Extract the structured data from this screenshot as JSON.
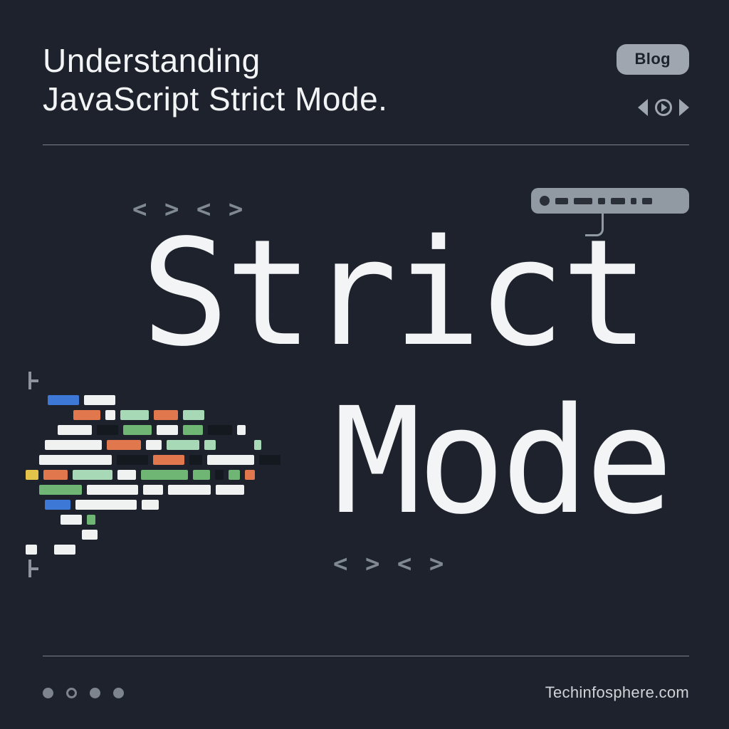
{
  "header": {
    "title_line1": "Understanding",
    "title_line2": "JavaScript Strict Mode.",
    "pill_label": "Blog"
  },
  "hero": {
    "angles": "< >  < >",
    "word1": "Strict",
    "word2": "Mode"
  },
  "footer": {
    "brand": "Techinfosphere.com"
  },
  "colors": {
    "background": "#1d222c",
    "foreground": "#f3f4f5",
    "muted": "#9fa6af",
    "accent_blue": "#3e78d6",
    "accent_orange": "#e1774c",
    "accent_green": "#6fb574",
    "accent_mint": "#a8d9b6",
    "accent_yellow": "#e4c34b"
  },
  "code_art": {
    "palette": {
      "b": "#3e78d6",
      "o": "#e1774c",
      "g": "#6fb574",
      "m": "#a8d9b6",
      "y": "#e4c34b",
      "w": "#f0f2f2",
      "d": "#14181f",
      "x": "transparent"
    },
    "rows": [
      [
        [
          "x",
          24
        ],
        [
          "b",
          44
        ],
        [
          "w",
          44
        ]
      ],
      [
        [
          "x",
          60
        ],
        [
          "o",
          38
        ],
        [
          "w",
          14
        ],
        [
          "m",
          40
        ],
        [
          "o",
          34
        ],
        [
          "m",
          30
        ]
      ],
      [
        [
          "x",
          38
        ],
        [
          "w",
          48
        ],
        [
          "d",
          30
        ],
        [
          "g",
          40
        ],
        [
          "w",
          30
        ],
        [
          "g",
          28
        ],
        [
          "d",
          34
        ],
        [
          "w",
          12
        ]
      ],
      [
        [
          "x",
          20
        ],
        [
          "w",
          80
        ],
        [
          "o",
          48
        ],
        [
          "w",
          22
        ],
        [
          "m",
          46
        ],
        [
          "m",
          16
        ],
        [
          "x",
          40
        ],
        [
          "m",
          10
        ]
      ],
      [
        [
          "x",
          12
        ],
        [
          "w",
          102
        ],
        [
          "d",
          44
        ],
        [
          "o",
          44
        ],
        [
          "d",
          18
        ],
        [
          "w",
          66
        ],
        [
          "d",
          30
        ]
      ],
      [
        [
          "y",
          18
        ],
        [
          "o",
          34
        ],
        [
          "m",
          56
        ],
        [
          "w",
          26
        ],
        [
          "g",
          66
        ],
        [
          "g",
          24
        ],
        [
          "d",
          12
        ],
        [
          "g",
          16
        ],
        [
          "o",
          14
        ]
      ],
      [
        [
          "x",
          12
        ],
        [
          "g",
          60
        ],
        [
          "w",
          72
        ],
        [
          "w",
          28
        ],
        [
          "w",
          60
        ],
        [
          "w",
          40
        ]
      ],
      [
        [
          "x",
          20
        ],
        [
          "b",
          36
        ],
        [
          "w",
          86
        ],
        [
          "w",
          24
        ]
      ],
      [
        [
          "x",
          42
        ],
        [
          "w",
          30
        ],
        [
          "g",
          12
        ]
      ],
      [
        [
          "x",
          72
        ],
        [
          "w",
          22
        ]
      ],
      [
        [
          "w",
          16
        ],
        [
          "x",
          10
        ],
        [
          "w",
          30
        ]
      ]
    ]
  }
}
